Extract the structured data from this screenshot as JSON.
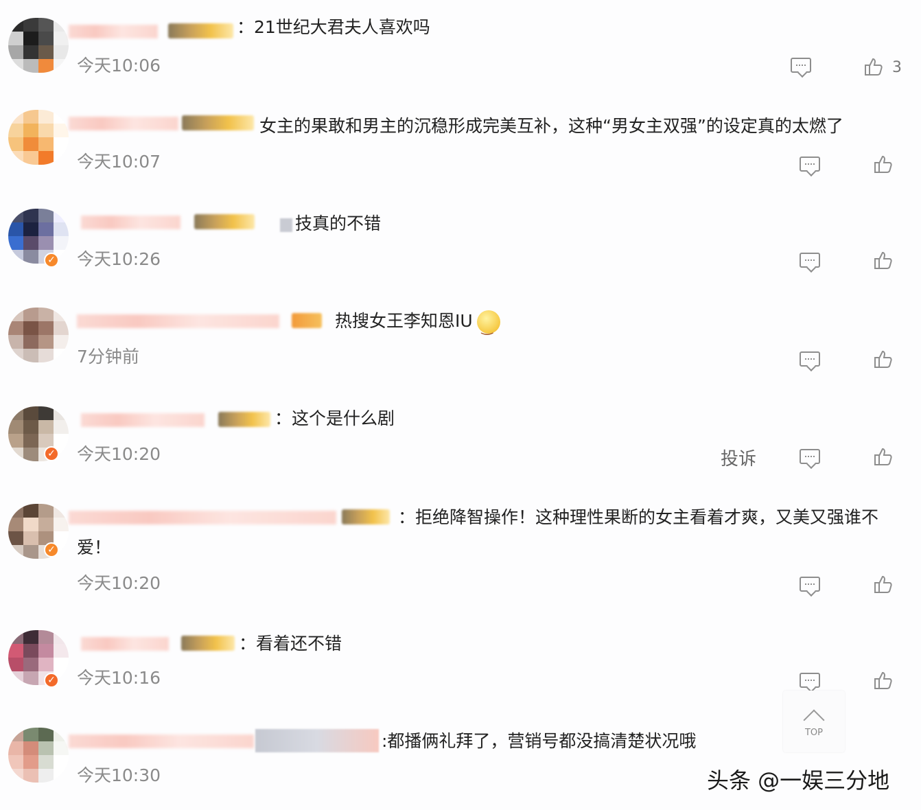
{
  "comments": [
    {
      "text": "：21世纪大君夫人喜欢吗",
      "time": "今天10:06",
      "like_count": "3"
    },
    {
      "text": "女主的果敢和男主的沉稳形成完美互补，这种“男女主双强”的设定真的太燃了",
      "time": "今天10:07"
    },
    {
      "text": "技真的不错",
      "time": "今天10:26"
    },
    {
      "text": "热搜女王李知恩IU",
      "time": "7分钟前"
    },
    {
      "text": "：这个是什么剧",
      "time": "今天10:20",
      "report": "投诉"
    },
    {
      "text": "：拒绝降智操作！这种理性果断的女主看着才爽，又美又强谁不爱！",
      "time": "今天10:20"
    },
    {
      "text": "：看着还不错",
      "time": "今天10:16"
    },
    {
      "text": ":都播俩礼拜了，营销号都没搞清楚状况哦",
      "time": "今天10:30"
    }
  ],
  "top_button": {
    "label": "TOP"
  },
  "watermark": "头条 @一娱三分地",
  "icons": {
    "reply": "comment-icon",
    "like": "thumbs-up-icon",
    "top": "chevron-up-icon"
  },
  "colors": {
    "time": "#8a8a8a",
    "text": "#222222",
    "icon": "#8d8d8d"
  }
}
